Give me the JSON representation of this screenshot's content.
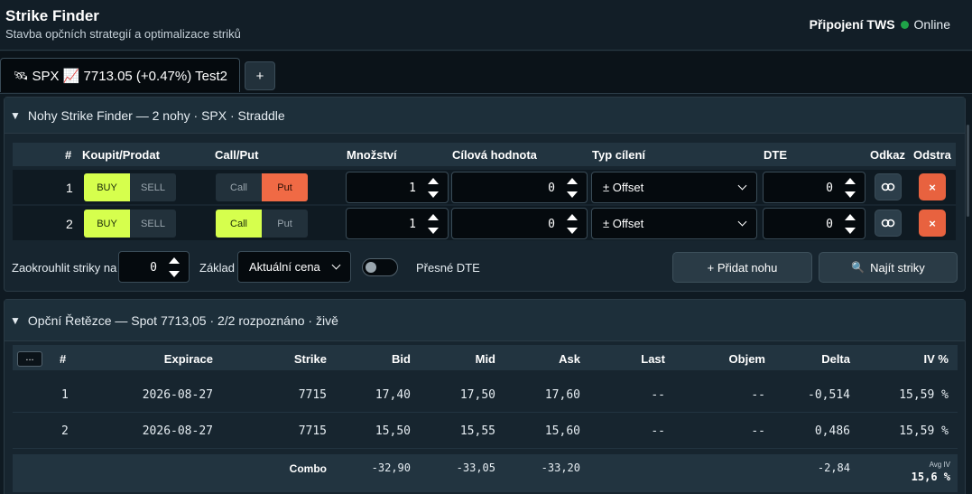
{
  "header": {
    "title": "Strike Finder",
    "subtitle": "Stavba opčních strategií a optimalizace striků",
    "connection_label": "Připojení TWS",
    "status": "Online",
    "status_color": "#1fa348"
  },
  "tabs": [
    {
      "icon": "satellite-icon",
      "icon_glyph": "🛰",
      "label": "SPX 📈 7713.05 (+0.47%) Test2"
    }
  ],
  "add_tab_label": "+",
  "legs_panel": {
    "title": "Nohy Strike Finder — 2 nohy · SPX · Straddle",
    "columns": [
      "#",
      "Koupit/Prodat",
      "Call/Put",
      "Množství",
      "Cílová hodnota",
      "Typ cílení",
      "DTE",
      "Odkaz",
      "Odstra"
    ],
    "legs": [
      {
        "num": "1",
        "buy": "BUY",
        "sell": "SELL",
        "side": "BUY",
        "call": "Call",
        "put": "Put",
        "right": "Put",
        "qty": "1",
        "target": "0",
        "target_type": "± Offset",
        "dte": "0"
      },
      {
        "num": "2",
        "buy": "BUY",
        "sell": "SELL",
        "side": "BUY",
        "call": "Call",
        "put": "Put",
        "right": "Call",
        "qty": "1",
        "target": "0",
        "target_type": "± Offset",
        "dte": "0"
      }
    ],
    "delete_glyph": "×",
    "round_label": "Zaokrouhlit striky na",
    "round_value": "0",
    "base_label": "Základ",
    "base_value": "Aktuální cena",
    "exact_dte_label": "Přesné DTE",
    "exact_dte_on": false,
    "add_leg_label": "+ Přidat nohu",
    "find_label": "Najít striky",
    "find_icon": "magnifier-icon",
    "find_glyph": "🔍"
  },
  "chain_panel": {
    "title": "Opční Řetězce — Spot 7713,05 · 2/2 rozpoznáno · živě",
    "menu_label": "...",
    "columns": [
      "#",
      "Expirace",
      "Strike",
      "Bid",
      "Mid",
      "Ask",
      "Last",
      "Objem",
      "Delta",
      "IV %"
    ],
    "rows": [
      {
        "num": "1",
        "expiry": "2026-08-27",
        "strike": "7715",
        "bid": "17,40",
        "mid": "17,50",
        "ask": "17,60",
        "last": "--",
        "volume": "--",
        "delta": "-0,514",
        "iv": "15,59 %"
      },
      {
        "num": "2",
        "expiry": "2026-08-27",
        "strike": "7715",
        "bid": "15,50",
        "mid": "15,55",
        "ask": "15,60",
        "last": "--",
        "volume": "--",
        "delta": "0,486",
        "iv": "15,59 %"
      }
    ],
    "combo": {
      "label": "Combo",
      "bid": "-32,90",
      "mid": "-33,05",
      "ask": "-33,20",
      "delta": "-2,84",
      "avg_iv_label": "Avg IV",
      "avg_iv": "15,6 %"
    }
  },
  "colors": {
    "accent_lime": "#d6ff4d",
    "accent_orange": "#f06a45",
    "background": "#0f1a22"
  }
}
